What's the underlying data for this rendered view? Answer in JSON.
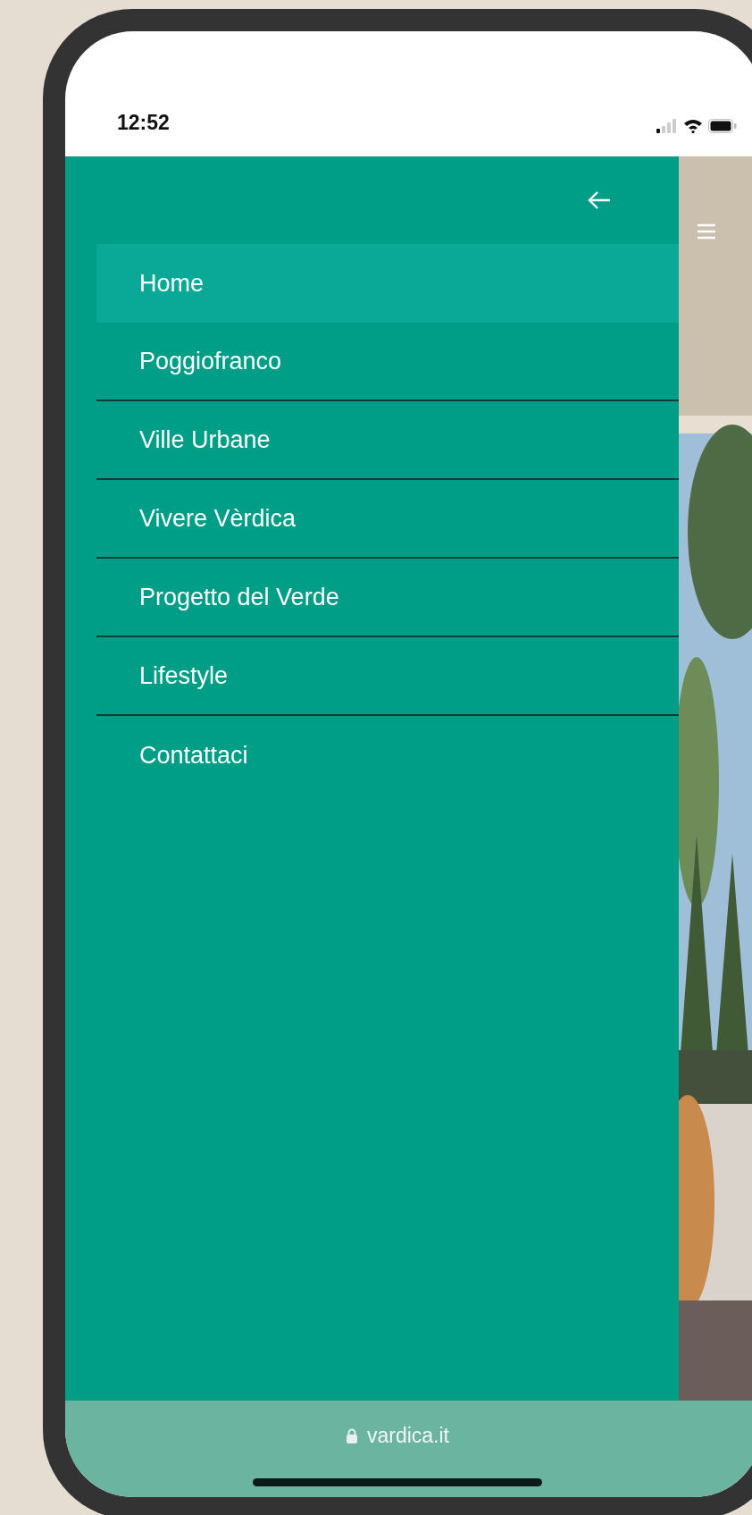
{
  "status_bar": {
    "time": "12:52"
  },
  "menu": {
    "items": [
      {
        "label": "Home",
        "selected": true
      },
      {
        "label": "Poggiofranco",
        "selected": false
      },
      {
        "label": "Ville Urbane",
        "selected": false
      },
      {
        "label": "Vivere Vèrdica",
        "selected": false
      },
      {
        "label": "Progetto del Verde",
        "selected": false
      },
      {
        "label": "Lifestyle",
        "selected": false
      },
      {
        "label": "Contattaci",
        "selected": false
      }
    ]
  },
  "address_bar": {
    "url": "vardica.it"
  }
}
